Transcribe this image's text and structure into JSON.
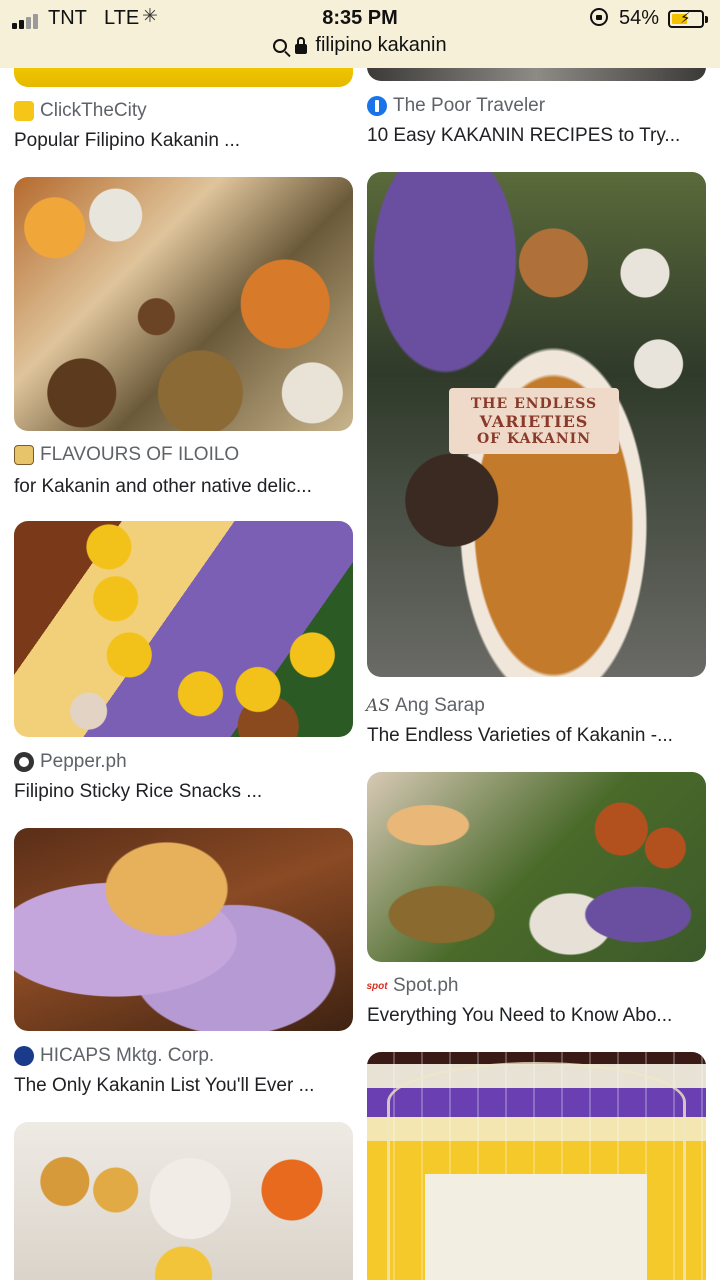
{
  "status_bar": {
    "carrier": "TNT",
    "network": "LTE",
    "time": "8:35 PM",
    "battery_percent": "54%",
    "battery_level": 0.54
  },
  "url_bar": {
    "query": "filipino kakanin",
    "search_icon": "search-icon",
    "lock_icon": "padlock-icon"
  },
  "results": {
    "left": [
      {
        "source": "ClickTheCity",
        "title": "Popular Filipino Kakanin ..."
      },
      {
        "source": "FLAVOURS OF ILOILO",
        "title": "for Kakanin and other native delic..."
      },
      {
        "source": "Pepper.ph",
        "title": "Filipino Sticky Rice Snacks ..."
      },
      {
        "source": "HICAPS Mktg. Corp.",
        "title": "The Only Kakanin List You'll Ever ..."
      }
    ],
    "right": [
      {
        "source": "The Poor Traveler",
        "title": "10 Easy KAKANIN RECIPES to Try..."
      },
      {
        "source": "Ang Sarap",
        "title": "The Endless Varieties of Kakanin -...",
        "image_text": [
          "THE ENDLESS",
          "VARIETIES",
          "OF KAKANIN"
        ],
        "badge": "AS"
      },
      {
        "source": "Spot.ph",
        "title": "Everything You Need to Know Abo...",
        "badge": "spot"
      }
    ]
  },
  "colors": {
    "status_bar_bg": "#f6f0d8",
    "battery_fill": "#f2c200",
    "text_primary": "#202124",
    "text_secondary": "#5f6368"
  }
}
